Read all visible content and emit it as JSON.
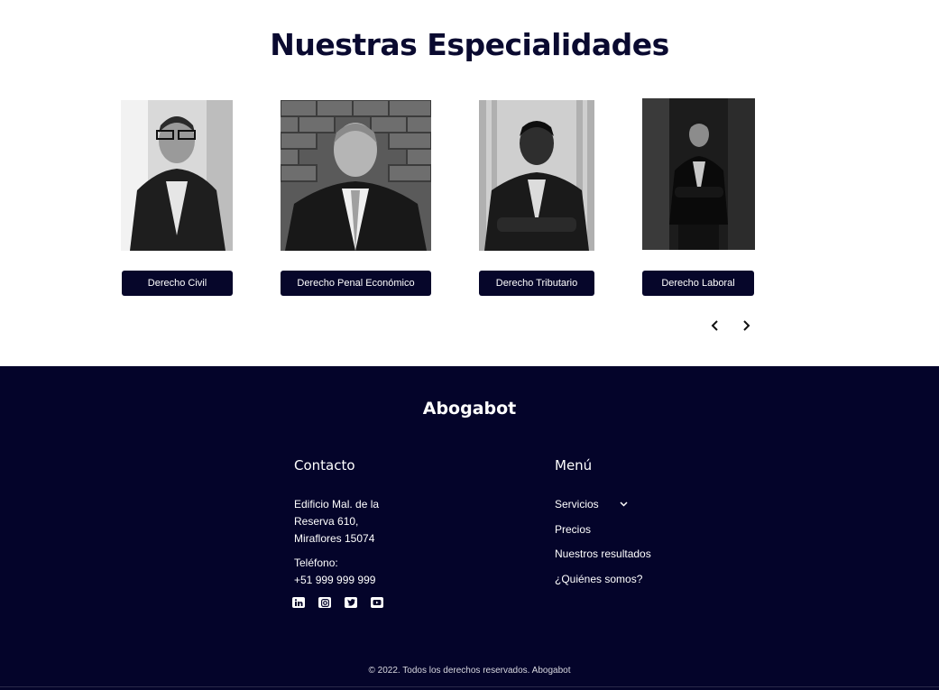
{
  "section": {
    "title": "Nuestras Especialidades"
  },
  "specialties": [
    {
      "label": "Derecho Civil"
    },
    {
      "label": "Derecho Penal Económico"
    },
    {
      "label": "Derecho Tributario"
    },
    {
      "label": "Derecho Laboral"
    }
  ],
  "carousel": {
    "prev_icon": "chevron-left-icon",
    "next_icon": "chevron-right-icon"
  },
  "footer": {
    "brand": "Abogabot",
    "contact": {
      "title": "Contacto",
      "address": [
        "Edificio Mal. de la",
        "Reserva 610,",
        "Miraflores 15074"
      ],
      "phone_label": "Teléfono:",
      "phone": "+51 999 999 999",
      "social": [
        "linkedin-icon",
        "instagram-icon",
        "twitter-icon",
        "youtube-icon"
      ]
    },
    "menu": {
      "title": "Menú",
      "items": [
        "Servicios",
        "Precios",
        "Nuestros resultados",
        "¿Quiénes somos?"
      ]
    },
    "copyright": "© 2022. Todos los derechos reservados. Abogabot"
  },
  "colors": {
    "navy": "#04042a",
    "button": "#06062a",
    "title": "#0a0a30"
  }
}
